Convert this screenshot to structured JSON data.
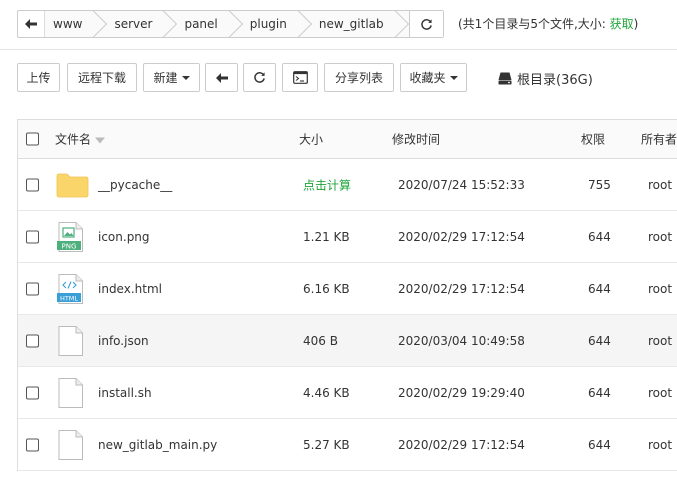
{
  "pathbar": {
    "crumbs": [
      "www",
      "server",
      "panel",
      "plugin",
      "new_gitlab"
    ]
  },
  "summary": {
    "text": "(共1个目录与5个文件,大小: ",
    "fetch": "获取",
    "close": ")"
  },
  "toolbar": {
    "upload": "上传",
    "remote_download": "远程下载",
    "new": "新建",
    "share_list": "分享列表",
    "favorites": "收藏夹",
    "disk": "根目录(36G)"
  },
  "table": {
    "headers": {
      "name": "文件名",
      "size": "大小",
      "mtime": "修改时间",
      "perm": "权限",
      "owner": "所有者"
    },
    "rows": [
      {
        "name": "__pycache__",
        "size": "点击计算",
        "mtime": "2020/07/24 15:52:33",
        "perm": "755",
        "owner": "root",
        "icon": "folder-icon"
      },
      {
        "name": "icon.png",
        "size": "1.21 KB",
        "mtime": "2020/02/29 17:12:54",
        "perm": "644",
        "owner": "root",
        "icon": "png-file-icon",
        "badge": "PNG"
      },
      {
        "name": "index.html",
        "size": "6.16 KB",
        "mtime": "2020/02/29 17:12:54",
        "perm": "644",
        "owner": "root",
        "icon": "html-file-icon",
        "badge": "HTML"
      },
      {
        "name": "info.json",
        "size": "406 B",
        "mtime": "2020/03/04 10:49:58",
        "perm": "644",
        "owner": "root",
        "icon": "file-icon"
      },
      {
        "name": "install.sh",
        "size": "4.46 KB",
        "mtime": "2020/02/29 19:29:40",
        "perm": "644",
        "owner": "root",
        "icon": "file-icon"
      },
      {
        "name": "new_gitlab_main.py",
        "size": "5.27 KB",
        "mtime": "2020/02/29 17:12:54",
        "perm": "644",
        "owner": "root",
        "icon": "file-icon"
      }
    ]
  },
  "colors": {
    "accent_green": "#20a53a",
    "folder_yellow": "#f9d56a",
    "png_green": "#4caf7d",
    "html_blue": "#3a9fd6"
  }
}
